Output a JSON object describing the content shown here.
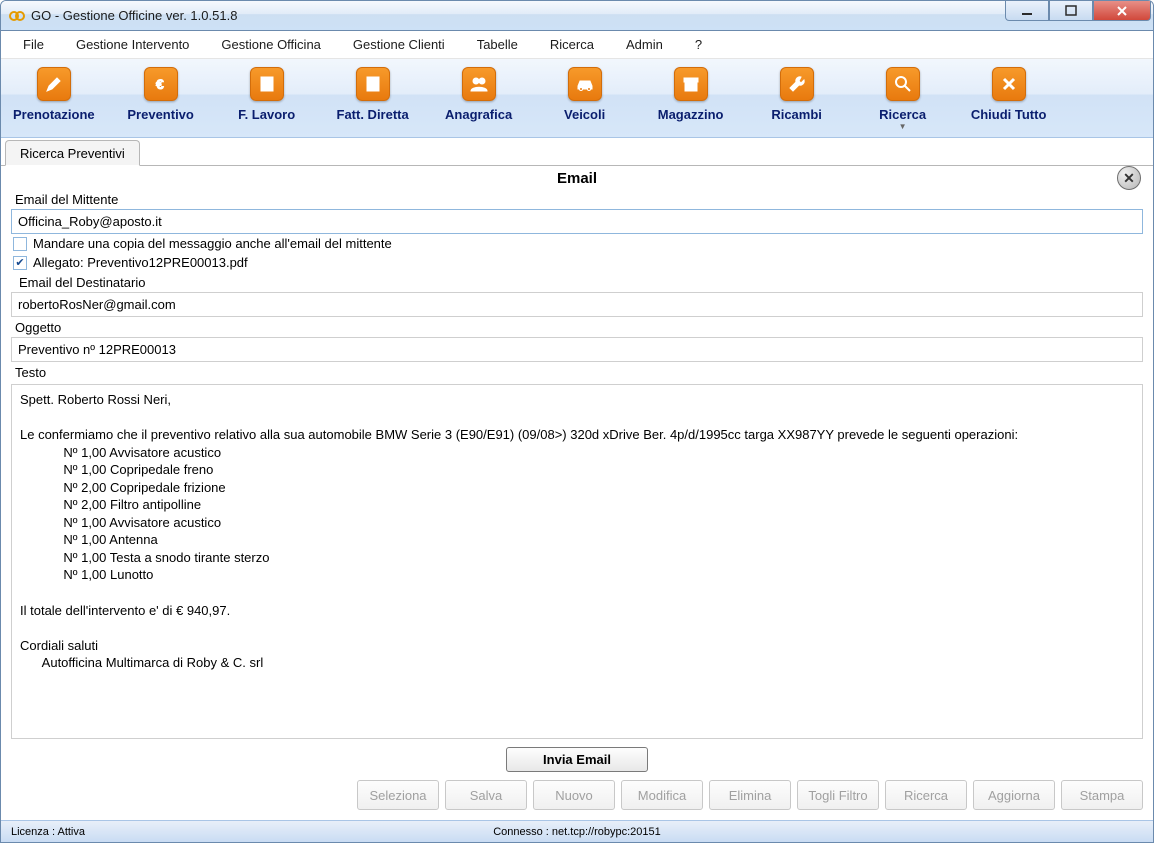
{
  "window": {
    "title": "GO - Gestione Officine ver. 1.0.51.8"
  },
  "menu": {
    "items": [
      "File",
      "Gestione Intervento",
      "Gestione Officina",
      "Gestione Clienti",
      "Tabelle",
      "Ricerca",
      "Admin",
      "?"
    ]
  },
  "toolbar": {
    "items": [
      {
        "label": "Prenotazione",
        "icon": "pencil"
      },
      {
        "label": "Preventivo",
        "icon": "euro"
      },
      {
        "label": "F. Lavoro",
        "icon": "doc"
      },
      {
        "label": "Fatt. Diretta",
        "icon": "doc-lines"
      },
      {
        "label": "Anagrafica",
        "icon": "users"
      },
      {
        "label": "Veicoli",
        "icon": "car"
      },
      {
        "label": "Magazzino",
        "icon": "archive"
      },
      {
        "label": "Ricambi",
        "icon": "wrench"
      },
      {
        "label": "Ricerca",
        "icon": "search",
        "dropdown": true
      },
      {
        "label": "Chiudi Tutto",
        "icon": "close-x"
      }
    ]
  },
  "tabs": {
    "active": "Ricerca Preventivi"
  },
  "email": {
    "title": "Email",
    "sender_label": "Email del Mittente",
    "sender_value": "Officina_Roby@aposto.it",
    "cc_self_label": "Mandare una copia del messaggio anche all'email del mittente",
    "cc_self_checked": false,
    "attachment_label": "Allegato: Preventivo12PRE00013.pdf",
    "attachment_checked": true,
    "recipient_label": "Email del Destinatario",
    "recipient_value": "robertoRosNer@gmail.com",
    "subject_label": "Oggetto",
    "subject_value": "Preventivo nº 12PRE00013",
    "body_label": "Testo",
    "body_text": "Spett. Roberto Rossi Neri,\n\nLe confermiamo che il preventivo relativo alla sua automobile BMW Serie 3 (E90/E91) (09/08>) 320d xDrive Ber. 4p/d/1995cc targa XX987YY prevede le seguenti operazioni:\n            Nº 1,00 Avvisatore acustico\n            Nº 1,00 Copripedale freno\n            Nº 2,00 Copripedale frizione\n            Nº 2,00 Filtro antipolline\n            Nº 1,00 Avvisatore acustico\n            Nº 1,00 Antenna\n            Nº 1,00 Testa a snodo tirante sterzo\n            Nº 1,00 Lunotto\n\nIl totale dell'intervento e' di € 940,97.\n\nCordiali saluti\n      Autofficina Multimarca di Roby & C. srl",
    "send_button": "Invia Email"
  },
  "actions": [
    "Seleziona",
    "Salva",
    "Nuovo",
    "Modifica",
    "Elimina",
    "Togli Filtro",
    "Ricerca",
    "Aggiorna",
    "Stampa"
  ],
  "status": {
    "left": "Licenza : Attiva",
    "center": "Connesso : net.tcp://robypc:20151"
  }
}
